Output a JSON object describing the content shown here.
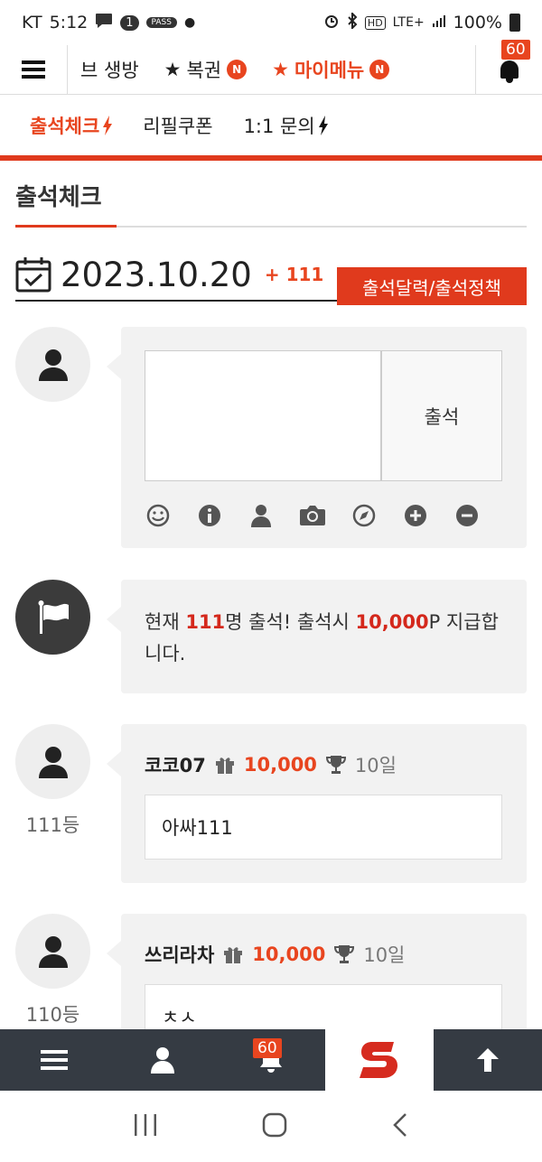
{
  "status_bar": {
    "carrier": "KT",
    "time": "5:12",
    "pass_badge": "PASS",
    "chat_count": "1",
    "network": "LTE+",
    "battery": "100%"
  },
  "top_nav": {
    "items": [
      {
        "label": "브 생방",
        "star": false,
        "new": false
      },
      {
        "label": "복권",
        "star": true,
        "new": true
      },
      {
        "label": "마이메뉴",
        "star": true,
        "new": true
      }
    ],
    "new_badge": "N",
    "star": "★",
    "notification_count": "60"
  },
  "sub_nav": {
    "tabs": [
      "출석체크",
      "리필쿠폰",
      "1:1 문의"
    ]
  },
  "page_title": "출석체크",
  "date": {
    "value": "2023.10.20",
    "count": "+ 111"
  },
  "policy_button": "출석달력/출석정책",
  "compose": {
    "textarea_value": "",
    "submit_label": "출석",
    "tools": [
      "smile-icon",
      "info-icon",
      "user-icon",
      "camera-icon",
      "compass-icon",
      "plus-circle-icon",
      "minus-circle-icon"
    ]
  },
  "notice": {
    "prefix": "현재 ",
    "count": "111",
    "mid": "명 출석! 출석시 ",
    "points": "10,000",
    "suffix": "P 지급합니다."
  },
  "entries": [
    {
      "rank": "111등",
      "name": "코코07",
      "points": "10,000",
      "days": "10일",
      "message": "아싸111"
    },
    {
      "rank": "110등",
      "name": "쓰리라차",
      "points": "10,000",
      "days": "10일",
      "message": "ㅊㅅ"
    }
  ],
  "bottom_bar": {
    "notification_count": "60",
    "items": [
      "menu-icon",
      "user-icon",
      "bell-icon",
      "logo",
      "arrow-up-icon"
    ]
  },
  "colors": {
    "accent": "#e8451f",
    "accent_dark": "#e03a1d",
    "bottom_bar": "#353b43"
  }
}
